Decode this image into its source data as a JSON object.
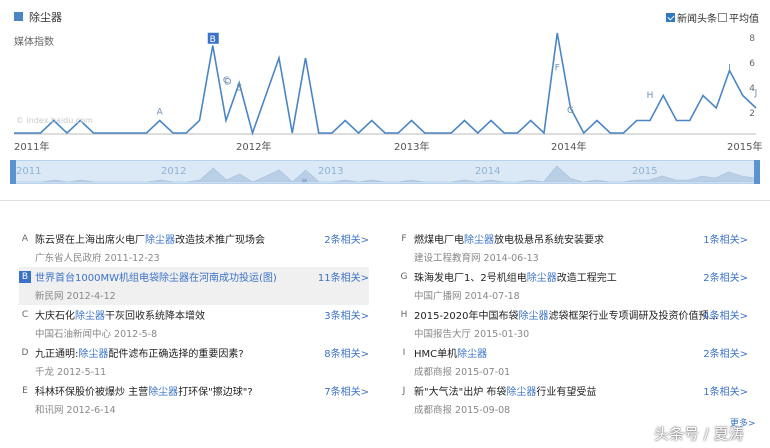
{
  "header": {
    "legend_color": "#4a86c5",
    "title": "除尘器",
    "news_checkbox_label": "新闻头条",
    "news_checked": true,
    "avg_checkbox_label": "平均值",
    "avg_checked": false
  },
  "chart": {
    "ylabel": "媒体指数",
    "watermark": "© index.baidu.com",
    "ytick_labels": [
      "8",
      "6",
      "4",
      "2"
    ],
    "xtick_labels": [
      "2011年",
      "2012年",
      "2013年",
      "2014年",
      "2015年"
    ],
    "range_labels": [
      "2011",
      "2012",
      "2013",
      "2014",
      "2015"
    ],
    "range_grip": "≡"
  },
  "chart_data": {
    "type": "line",
    "ylim": [
      0,
      8
    ],
    "xlim": [
      "2011-01",
      "2015-09"
    ],
    "series": [
      {
        "name": "除尘器",
        "color": "#4a86c5",
        "points": [
          [
            "2011-01",
            0
          ],
          [
            "2011-03",
            0
          ],
          [
            "2011-04",
            1
          ],
          [
            "2011-05",
            0
          ],
          [
            "2011-06",
            1
          ],
          [
            "2011-07",
            0
          ],
          [
            "2011-08",
            0
          ],
          [
            "2011-11",
            0
          ],
          [
            "2011-12",
            1
          ],
          [
            "2012-01",
            0
          ],
          [
            "2012-02",
            0
          ],
          [
            "2012-03",
            1
          ],
          [
            "2012-04",
            7
          ],
          [
            "2012-05",
            1
          ],
          [
            "2012-06",
            4
          ],
          [
            "2012-07",
            0
          ],
          [
            "2012-08",
            3
          ],
          [
            "2012-09",
            6
          ],
          [
            "2012-10",
            0
          ],
          [
            "2012-11",
            6
          ],
          [
            "2012-12",
            0
          ],
          [
            "2013-01",
            0
          ],
          [
            "2013-02",
            1
          ],
          [
            "2013-03",
            0
          ],
          [
            "2013-04",
            1
          ],
          [
            "2013-05",
            0
          ],
          [
            "2013-06",
            0
          ],
          [
            "2013-07",
            1
          ],
          [
            "2013-08",
            0
          ],
          [
            "2013-10",
            0
          ],
          [
            "2013-11",
            1
          ],
          [
            "2013-12",
            0
          ],
          [
            "2014-01",
            1
          ],
          [
            "2014-02",
            0
          ],
          [
            "2014-03",
            0
          ],
          [
            "2014-04",
            1
          ],
          [
            "2014-05",
            0
          ],
          [
            "2014-06",
            8
          ],
          [
            "2014-07",
            2
          ],
          [
            "2014-08",
            0
          ],
          [
            "2014-09",
            1
          ],
          [
            "2014-10",
            0
          ],
          [
            "2014-11",
            0
          ],
          [
            "2014-12",
            1
          ],
          [
            "2015-01",
            1
          ],
          [
            "2015-02",
            3
          ],
          [
            "2015-03",
            1
          ],
          [
            "2015-04",
            1
          ],
          [
            "2015-05",
            3
          ],
          [
            "2015-06",
            2
          ],
          [
            "2015-07",
            5
          ],
          [
            "2015-08",
            3
          ],
          [
            "2015-09",
            2
          ]
        ]
      }
    ],
    "annotations": [
      {
        "label": "A",
        "x": "2011-12",
        "y": 1.5
      },
      {
        "label": "B",
        "x": "2012-04",
        "y": 7.3
      },
      {
        "label": "C",
        "x": "2012-05",
        "y": 4.0
      },
      {
        "label": "D",
        "x": "2012-05",
        "y": 3.9
      },
      {
        "label": "E",
        "x": "2012-06",
        "y": 3.4
      },
      {
        "label": "F",
        "x": "2014-06",
        "y": 5.0
      },
      {
        "label": "G",
        "x": "2014-07",
        "y": 1.6
      },
      {
        "label": "H",
        "x": "2015-01",
        "y": 2.8
      },
      {
        "label": "I",
        "x": "2015-07",
        "y": 5.0
      },
      {
        "label": "J",
        "x": "2015-09",
        "y": 3.0
      }
    ],
    "ylabel": "媒体指数",
    "grid": false,
    "legend": "top-left"
  },
  "news": {
    "left": [
      {
        "letter": "A",
        "title_pre": "陈云贤在上海出席火电厂",
        "title_hl": "除尘器",
        "title_post": "改造技术推广现场会",
        "source": "广东省人民政府 2011-12-23",
        "related": "2条相关>"
      },
      {
        "letter": "B",
        "title_pre": "世界首台1000MW机组电袋",
        "title_hl": "除尘器",
        "title_post": "在河南成功投运(图)",
        "source": "新民网 2012-4-12",
        "related": "11条相关>",
        "active": true
      },
      {
        "letter": "C",
        "title_pre": "大庆石化",
        "title_hl": "除尘器",
        "title_post": "干灰回收系统降本增效",
        "source": "中国石油新闻中心 2012-5-8",
        "related": "3条相关>"
      },
      {
        "letter": "D",
        "title_pre": "九正通明:",
        "title_hl": "除尘器",
        "title_post": "配件滤布正确选择的重要因素?",
        "source": "千龙 2012-5-11",
        "related": "8条相关>"
      },
      {
        "letter": "E",
        "title_pre": "科林环保股价被爆炒 主营",
        "title_hl": "除尘器",
        "title_post": "打环保\"擦边球\"?",
        "source": "和讯网 2012-6-14",
        "related": "7条相关>"
      }
    ],
    "right": [
      {
        "letter": "F",
        "title_pre": "燃煤电厂电",
        "title_hl": "除尘器",
        "title_post": "放电极悬吊系统安装要求",
        "source": "建设工程教育网 2014-06-13",
        "related": "1条相关>"
      },
      {
        "letter": "G",
        "title_pre": "珠海发电厂1、2号机组电",
        "title_hl": "除尘器",
        "title_post": "改造工程完工",
        "source": "中国广播网 2014-07-18",
        "related": "2条相关>"
      },
      {
        "letter": "H",
        "title_pre": "2015-2020年中国布袋",
        "title_hl": "除尘器",
        "title_post": "滤袋框架行业专项调研及投资价值预...",
        "source": "中国报告大厅 2015-01-30",
        "related": "4条相关>"
      },
      {
        "letter": "I",
        "title_pre": "HMC单机",
        "title_hl": "除尘器",
        "title_post": "",
        "source": "成都商报 2015-07-01",
        "related": "2条相关>"
      },
      {
        "letter": "J",
        "title_pre": "新\"大气法\"出炉 布袋",
        "title_hl": "除尘器",
        "title_post": "行业有望受益",
        "source": "成都商报 2015-09-08",
        "related": "1条相关>"
      }
    ],
    "more_label": "更多>"
  },
  "footer": {
    "brand": "头条号 / 夏涛"
  }
}
